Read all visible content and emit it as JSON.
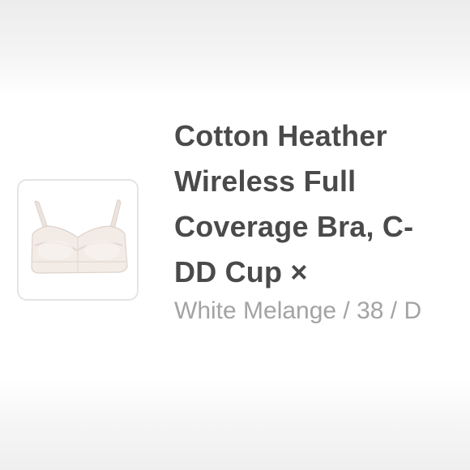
{
  "cart_item": {
    "image_alt": "bra-product-image",
    "title": "Cotton Heather Wireless Full Coverage Bra, C-DD Cup",
    "remove_glyph": "×",
    "variant": "White Melange / 38 / D",
    "product_color": "#f3ebe6"
  }
}
